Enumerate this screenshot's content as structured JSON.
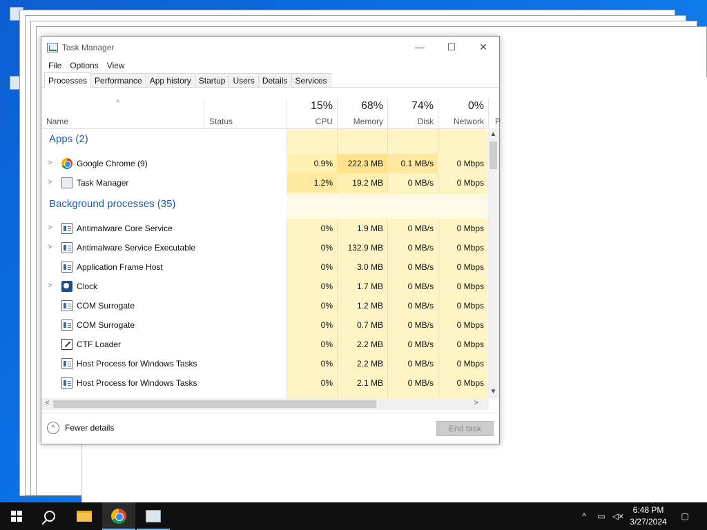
{
  "window": {
    "title": "Task Manager",
    "controls": {
      "minimize": "—",
      "maximize": "☐",
      "close": "✕"
    }
  },
  "menu": [
    "File",
    "Options",
    "View"
  ],
  "tabs": [
    "Processes",
    "Performance",
    "App history",
    "Startup",
    "Users",
    "Details",
    "Services"
  ],
  "active_tab": "Processes",
  "columns": {
    "name": "Name",
    "status": "Status",
    "cpu": {
      "pct": "15%",
      "label": "CPU"
    },
    "memory": {
      "pct": "68%",
      "label": "Memory"
    },
    "disk": {
      "pct": "74%",
      "label": "Disk"
    },
    "network": {
      "pct": "0%",
      "label": "Network"
    },
    "power_partial": "P"
  },
  "groups": {
    "apps": "Apps (2)",
    "background": "Background processes (35)"
  },
  "apps": [
    {
      "name": "Google Chrome (9)",
      "icon": "chrome-icon",
      "expandable": true,
      "cpu": "0.9%",
      "memory": "222.3 MB",
      "disk": "0.1 MB/s",
      "network": "0 Mbps"
    },
    {
      "name": "Task Manager",
      "icon": "task-manager-icon",
      "expandable": true,
      "cpu": "1.2%",
      "memory": "19.2 MB",
      "disk": "0 MB/s",
      "network": "0 Mbps"
    }
  ],
  "background": [
    {
      "name": "Antimalware Core Service",
      "icon": "app-icon",
      "expandable": true,
      "cpu": "0%",
      "memory": "1.9 MB",
      "disk": "0 MB/s",
      "network": "0 Mbps"
    },
    {
      "name": "Antimalware Service Executable",
      "icon": "app-icon",
      "expandable": true,
      "cpu": "0%",
      "memory": "132.9 MB",
      "disk": "0 MB/s",
      "network": "0 Mbps"
    },
    {
      "name": "Application Frame Host",
      "icon": "app-icon",
      "expandable": false,
      "cpu": "0%",
      "memory": "3.0 MB",
      "disk": "0 MB/s",
      "network": "0 Mbps"
    },
    {
      "name": "Clock",
      "icon": "clock-icon",
      "expandable": true,
      "cpu": "0%",
      "memory": "1.7 MB",
      "disk": "0 MB/s",
      "network": "0 Mbps"
    },
    {
      "name": "COM Surrogate",
      "icon": "app-icon",
      "expandable": false,
      "cpu": "0%",
      "memory": "1.2 MB",
      "disk": "0 MB/s",
      "network": "0 Mbps"
    },
    {
      "name": "COM Surrogate",
      "icon": "app-icon",
      "expandable": false,
      "cpu": "0%",
      "memory": "0.7 MB",
      "disk": "0 MB/s",
      "network": "0 Mbps"
    },
    {
      "name": "CTF Loader",
      "icon": "ctf-loader-icon",
      "expandable": false,
      "cpu": "0%",
      "memory": "2.2 MB",
      "disk": "0 MB/s",
      "network": "0 Mbps"
    },
    {
      "name": "Host Process for Windows Tasks",
      "icon": "app-icon",
      "expandable": false,
      "cpu": "0%",
      "memory": "2.2 MB",
      "disk": "0 MB/s",
      "network": "0 Mbps"
    },
    {
      "name": "Host Process for Windows Tasks",
      "icon": "app-icon",
      "expandable": false,
      "cpu": "0%",
      "memory": "2.1 MB",
      "disk": "0 MB/s",
      "network": "0 Mbps"
    }
  ],
  "footer": {
    "fewer_details": "Fewer details",
    "end_task": "End task"
  },
  "colors": {
    "heat_light": "#fff4c4",
    "heat_mid": "#fff0b0",
    "heat_strong": "#ffe28a",
    "group_title": "#1e5aa8",
    "taskbar": "#101010",
    "desktop": "#0a6fe0"
  },
  "taskbar": {
    "time": "6:48 PM",
    "date": "3/27/2024",
    "tray_icons": [
      "chevron-up-icon",
      "network-icon",
      "volume-muted-icon",
      "notification-icon"
    ]
  }
}
